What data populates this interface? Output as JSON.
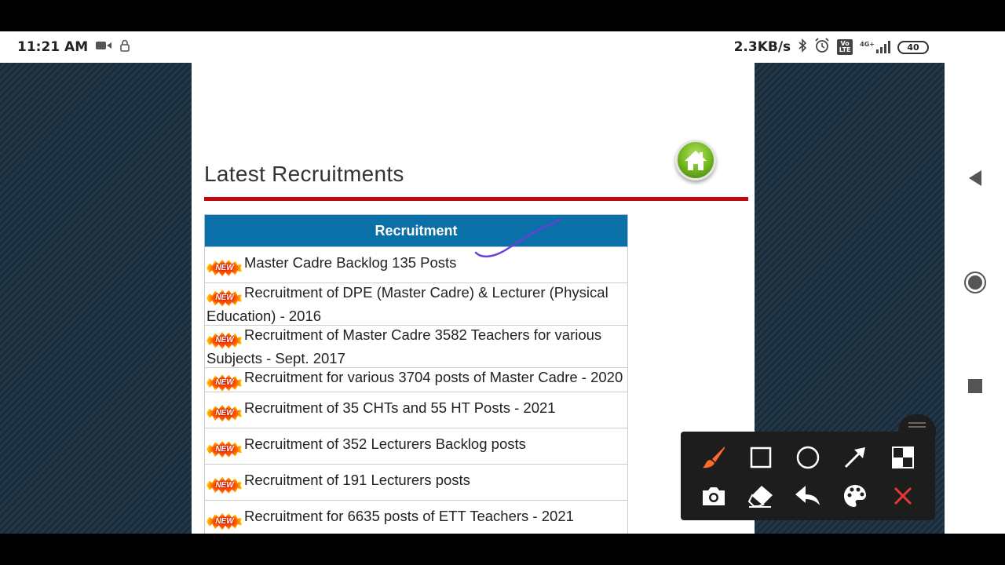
{
  "status_bar": {
    "time": "11:21 AM",
    "net_speed": "2.3KB/s",
    "signal_label": "4G+",
    "battery": "40",
    "volte": "Vo LTE"
  },
  "page": {
    "title": "Latest Recruitments",
    "table_header": "Recruitment",
    "badge_text": "NEW",
    "rows": [
      "Master Cadre Backlog 135 Posts",
      "Recruitment of DPE (Master Cadre) & Lecturer (Physical Education) - 2016",
      "Recruitment of Master Cadre 3582 Teachers for various Subjects - Sept. 2017",
      "Recruitment for various 3704 posts of Master Cadre - 2020",
      "Recruitment of 35 CHTs and 55 HT Posts - 2021",
      "Recruitment of 352 Lecturers Backlog posts",
      "Recruitment of 191 Lecturers posts",
      "Recruitment for 6635 posts of ETT Teachers - 2021"
    ]
  },
  "colors": {
    "header_blue": "#0b6fa8",
    "rule_red": "#c0080f",
    "brush_orange": "#ff6a2a",
    "close_red": "#e53935",
    "annotation_purple": "#6a3fd6"
  },
  "toolbar_icons": [
    "brush-icon",
    "rectangle-icon",
    "circle-icon",
    "arrow-icon",
    "mosaic-icon",
    "camera-icon",
    "eraser-icon",
    "undo-icon",
    "palette-icon",
    "close-icon"
  ],
  "nav_icons": [
    "back-icon",
    "home-icon",
    "recents-icon"
  ]
}
